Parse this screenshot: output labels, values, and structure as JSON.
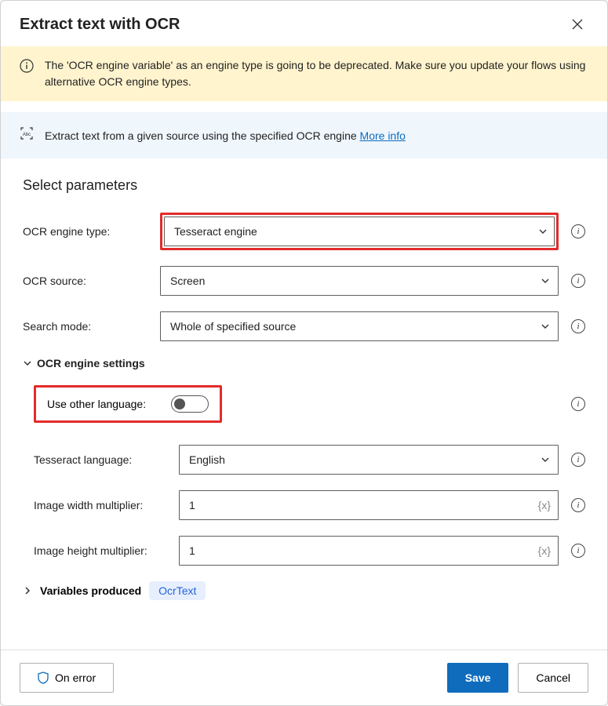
{
  "header": {
    "title": "Extract text with OCR"
  },
  "warning": {
    "text": "The 'OCR engine variable' as an engine type is going to be deprecated.  Make sure you update your flows using alternative OCR engine types."
  },
  "info": {
    "text": "Extract text from a given source using the specified OCR engine ",
    "link": "More info"
  },
  "section_title": "Select parameters",
  "fields": {
    "engine_type": {
      "label": "OCR engine type:",
      "value": "Tesseract engine"
    },
    "ocr_source": {
      "label": "OCR source:",
      "value": "Screen"
    },
    "search_mode": {
      "label": "Search mode:",
      "value": "Whole of specified source"
    }
  },
  "engine_settings": {
    "title": "OCR engine settings",
    "use_other_language": {
      "label": "Use other language:",
      "on": false
    },
    "tesseract_language": {
      "label": "Tesseract language:",
      "value": "English"
    },
    "width_multiplier": {
      "label": "Image width multiplier:",
      "value": "1",
      "suffix": "{x}"
    },
    "height_multiplier": {
      "label": "Image height multiplier:",
      "value": "1",
      "suffix": "{x}"
    }
  },
  "variables": {
    "label": "Variables produced",
    "badge": "OcrText"
  },
  "footer": {
    "on_error": "On error",
    "save": "Save",
    "cancel": "Cancel"
  }
}
